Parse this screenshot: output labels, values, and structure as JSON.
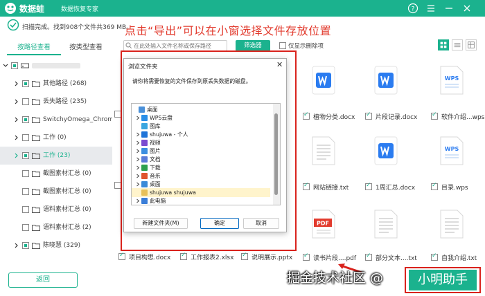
{
  "app": {
    "name": "数据蛙",
    "subtitle": "数据恢复专家",
    "help_icon": "question-circle-icon",
    "colors": {
      "brand": "#1bb28e",
      "annotation": "#e23b2e"
    }
  },
  "status": {
    "text": "扫描完成。找到908个文件共369 MB。"
  },
  "headline": "点击“导出”可以在小窗选择文件存放位置",
  "left": {
    "tabs": [
      "按路径查看",
      "按类型查看"
    ],
    "tree": [
      {
        "label": "其他路径 (268)",
        "state": "partial"
      },
      {
        "label": "丢失路径 (235)",
        "state": "empty"
      },
      {
        "label": "SwitchyOmega_Chromium",
        "state": "partial"
      },
      {
        "label": "工作 (0)",
        "state": "empty"
      },
      {
        "label": "工作 (23)",
        "state": "partial",
        "selected": true
      },
      {
        "label": "截图素材汇总 (0)",
        "state": "empty"
      },
      {
        "label": "截图素材汇总 (0)",
        "state": "empty"
      },
      {
        "label": "语料素材汇总 (0)",
        "state": "empty"
      },
      {
        "label": "语料素材汇总 (2)",
        "state": "empty"
      },
      {
        "label": "陈晓慧 (329)",
        "state": "partial"
      }
    ],
    "back_label": "返回"
  },
  "toolbar": {
    "search_placeholder": "在此处输入文件名称或保存路径",
    "filter_label": "筛选器",
    "only_deleted_label": "仅显示删除项"
  },
  "grid": {
    "row1": [
      {
        "label": "植物分类.docx",
        "type": "docx"
      },
      {
        "label": "片段记录.docx",
        "type": "docx"
      },
      {
        "label": "软件介绍...wps",
        "type": "wps"
      }
    ],
    "row2": [
      {
        "label": "网站链接.txt",
        "type": "txt"
      },
      {
        "label": "1周汇总.docx",
        "type": "docx"
      },
      {
        "label": "目录.wps",
        "type": "wps"
      }
    ],
    "row3": [
      {
        "label": "读书片段....pdf",
        "type": "pdf"
      },
      {
        "label": "部分文本....txt",
        "type": "txt"
      },
      {
        "label": "自我介绍.txt",
        "type": "txt"
      }
    ],
    "bottom": [
      "项目构思.docx",
      "工作报表2.xlsx",
      "说明展示.pptx"
    ],
    "pdf_text": "PDF",
    "wps_text": "WPS"
  },
  "dialog": {
    "title": "浏览文件夹",
    "description": "请你将需要恢复的文件保存到原丢失数据的磁盘。",
    "tree": [
      {
        "label": "桌面",
        "indent": 0,
        "chev": false,
        "color": "#4a90d9"
      },
      {
        "label": "WPS云盘",
        "indent": 1,
        "chev": true,
        "color": "#2a8fe8"
      },
      {
        "label": "图库",
        "indent": 1,
        "chev": false,
        "color": "#3aa6e0"
      },
      {
        "label": "shujuwa - 个人",
        "indent": 1,
        "chev": true,
        "color": "#1e73d8"
      },
      {
        "label": "视频",
        "indent": 1,
        "chev": true,
        "color": "#7b4bd0"
      },
      {
        "label": "图片",
        "indent": 1,
        "chev": true,
        "color": "#3c8ee0"
      },
      {
        "label": "文档",
        "indent": 1,
        "chev": true,
        "color": "#5a7bd8"
      },
      {
        "label": "下载",
        "indent": 1,
        "chev": true,
        "color": "#2ea04e"
      },
      {
        "label": "音乐",
        "indent": 1,
        "chev": true,
        "color": "#e0552e"
      },
      {
        "label": "桌面",
        "indent": 1,
        "chev": true,
        "color": "#3a8ad8"
      },
      {
        "label": "shujuwa shujuwa",
        "indent": 1,
        "chev": false,
        "color": "#e8c15a",
        "selected": true
      },
      {
        "label": "此电脑",
        "indent": 1,
        "chev": true,
        "color": "#3a7ed8"
      }
    ],
    "new_folder": "新建文件夹(M)",
    "ok": "确定",
    "cancel": "取消"
  },
  "watermark": "掘金技术社区 @",
  "export_label": "小明助手"
}
